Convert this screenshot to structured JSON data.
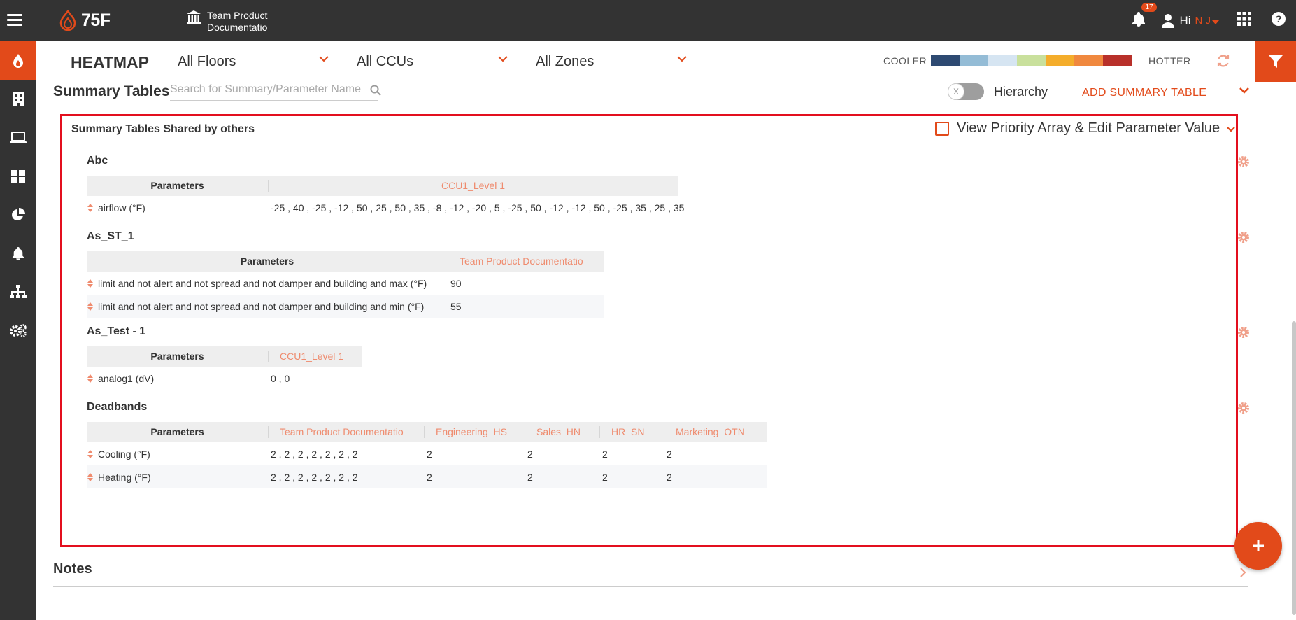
{
  "topbar": {
    "brand": "75F",
    "org_name": "Team Product Documentatio",
    "notifications_count": "17",
    "greeting": "Hi",
    "user_initials": "N J"
  },
  "toolbar": {
    "heatmap_title": "HEATMAP",
    "floors": "All Floors",
    "ccus": "All CCUs",
    "zones": "All Zones",
    "cooler_label": "COOLER",
    "hotter_label": "HOTTER",
    "heat_scale": [
      "#2e4a72",
      "#94bcd6",
      "#d6e5f2",
      "#c9e09c",
      "#f4ad2b",
      "#f0883e",
      "#b8302a"
    ]
  },
  "summary": {
    "title": "Summary Tables",
    "search_placeholder": "Search for Summary/Parameter Name",
    "hierarchy_label": "Hierarchy",
    "toggle_text": "X",
    "add_label": "ADD SUMMARY TABLE",
    "shared_title": "Summary Tables Shared by others",
    "view_priority_label": "View Priority Array & Edit Parameter Value"
  },
  "tables": [
    {
      "title": "Abc",
      "param_header": "Parameters",
      "columns": [
        "CCU1_Level 1"
      ],
      "rows": [
        {
          "name": "airflow  (°F)",
          "values": [
            "-25 , 40 , -25 , -12 , 50 , 25 , 50 , 35 , -8 , -12 , -20 , 5 , -25 , 50 , -12 , -12 , 50 , -25 , 35 , 25 , 35"
          ]
        }
      ]
    },
    {
      "title": "As_ST_1",
      "param_header": "Parameters",
      "columns": [
        "Team Product Documentatio"
      ],
      "rows": [
        {
          "name": "limit and not alert and not spread and not damper and building and max  (°F)",
          "values": [
            "90"
          ]
        },
        {
          "name": "limit and not alert and not spread and not damper and building and min  (°F)",
          "values": [
            "55"
          ]
        }
      ]
    },
    {
      "title": "As_Test - 1",
      "param_header": "Parameters",
      "columns": [
        "CCU1_Level 1"
      ],
      "rows": [
        {
          "name": "analog1  (dV)",
          "values": [
            "0 , 0"
          ]
        }
      ]
    },
    {
      "title": "Deadbands",
      "param_header": "Parameters",
      "columns": [
        "Team Product Documentatio",
        "Engineering_HS",
        "Sales_HN",
        "HR_SN",
        "Marketing_OTN"
      ],
      "rows": [
        {
          "name": "Cooling  (°F)",
          "values": [
            "2 , 2 , 2 , 2 , 2 , 2 , 2",
            "2",
            "2",
            "2",
            "2"
          ]
        },
        {
          "name": "Heating  (°F)",
          "values": [
            "2 , 2 , 2 , 2 , 2 , 2 , 2",
            "2",
            "2",
            "2",
            "2"
          ]
        }
      ]
    }
  ],
  "notes": {
    "title": "Notes"
  }
}
